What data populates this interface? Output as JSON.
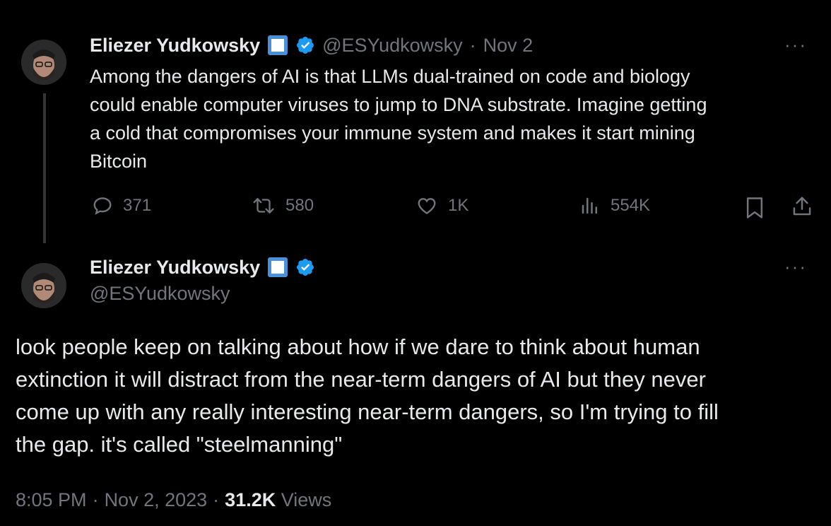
{
  "tweet1": {
    "author_name": "Eliezer Yudkowsky",
    "handle": "@ESYudkowsky",
    "separator": "·",
    "date": "Nov 2",
    "more": "···",
    "text_lines": [
      "Among the dangers of AI is that LLMs dual-trained on code and biology",
      "could enable computer viruses to jump to DNA substrate.  Imagine getting",
      "a cold that compromises your immune system and makes it start mining",
      "Bitcoin"
    ],
    "stats": {
      "replies": "371",
      "retweets": "580",
      "likes": "1K",
      "views": "554K"
    }
  },
  "tweet2": {
    "author_name": "Eliezer Yudkowsky",
    "handle": "@ESYudkowsky",
    "more": "···",
    "text_lines": [
      "look people keep on talking about how if we dare to think about human",
      "extinction it will distract from the near-term dangers of AI but they never",
      "come up with any really interesting near-term dangers, so I'm trying to fill",
      "the gap.  it's called \"steelmanning\""
    ],
    "meta": {
      "time": "8:05 PM",
      "sep1": "·",
      "date": "Nov 2, 2023",
      "sep2": "·",
      "views_count": "31.2K",
      "views_label": "Views"
    }
  },
  "colors": {
    "background": "#000000",
    "text": "#e7e9ea",
    "muted": "#71767b",
    "verified": "#1d9bf0",
    "thread_line": "#333639"
  },
  "icons": [
    "reply-icon",
    "retweet-icon",
    "like-icon",
    "views-icon",
    "bookmark-icon",
    "share-icon",
    "verified-badge-icon",
    "square-badge-icon"
  ]
}
